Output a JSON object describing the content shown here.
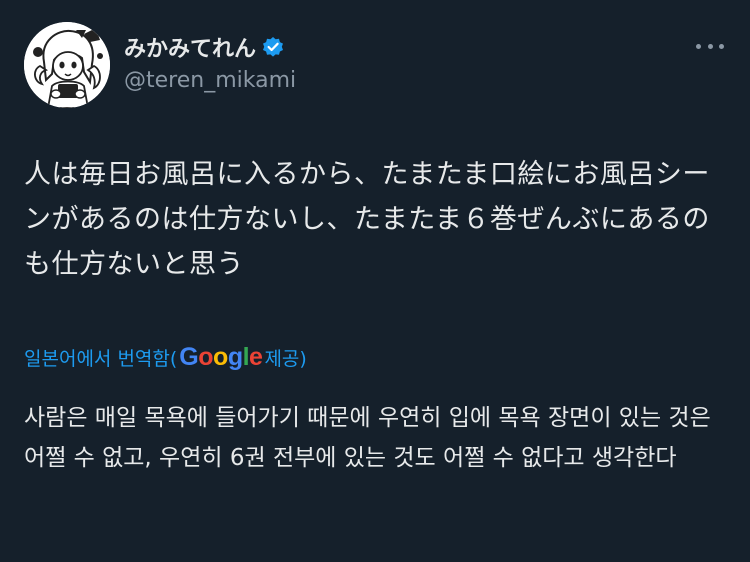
{
  "author": {
    "display_name": "みかみてれん",
    "handle": "@teren_mikami",
    "verified": true
  },
  "tweet": {
    "text_ja": "人は毎日お風呂に入るから、たまたま口絵にお風呂シーンがあるのは仕方ないし、たまたま６巻ぜんぶにあるのも仕方ないと思う"
  },
  "translation": {
    "prefix": "일본어에서 번역함(",
    "provider": "Google",
    "suffix": "제공)",
    "text_ko": "사람은 매일 목욕에 들어가기 때문에 우연히 입에 목욕 장면이 있는 것은 어쩔 수 없고, 우연히 6권 전부에 있는 것도 어쩔 수 없다고 생각한다"
  },
  "colors": {
    "background": "#15202b",
    "link": "#1d9bf0",
    "verified_badge": "#1d9bf0",
    "secondary_text": "#8b98a5"
  },
  "icons": {
    "verified": "verified-badge-icon",
    "more": "more-options-icon"
  }
}
